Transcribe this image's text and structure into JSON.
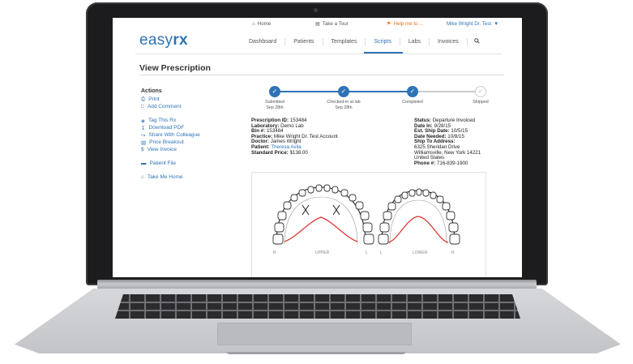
{
  "topbar": {
    "home": "Home",
    "tour": "Take a Tour",
    "help": "Help me to ...",
    "user": "Mike Wright Dr. Test"
  },
  "logo": {
    "part1": "easy",
    "part2": "rx"
  },
  "nav": [
    "Dashboard",
    "Patients",
    "Templates",
    "Scripts",
    "Labs",
    "Invoices"
  ],
  "nav_active": "Scripts",
  "page_title": "View Prescription",
  "actions": {
    "heading": "Actions",
    "group1": [
      "Print",
      "Add Comment"
    ],
    "group2": [
      "Tag This Rx",
      "Download PDF",
      "Share With Colleague",
      "Price Breakout",
      "View Invoice"
    ],
    "group3": [
      "Patient File"
    ],
    "group4": [
      "Take Me Home"
    ]
  },
  "steps": [
    {
      "label": "Submitted",
      "date": "Sep 28th",
      "done": true
    },
    {
      "label": "Checked-in at lab",
      "date": "Sep 28th",
      "done": true
    },
    {
      "label": "Completed",
      "date": "",
      "done": true
    },
    {
      "label": "Shipped",
      "date": "",
      "done": false
    }
  ],
  "details_left": {
    "prescription_id_label": "Prescription ID:",
    "prescription_id": "153484",
    "laboratory_label": "Laboratory:",
    "laboratory": "Demo Lab",
    "bin_label": "Bin #:",
    "bin": "153484",
    "practice_label": "Practice:",
    "practice": "Mike Wright Dr. Test Account",
    "doctor_label": "Doctor:",
    "doctor": "James Wright",
    "patient_label": "Patient:",
    "patient": "Theresa Avila",
    "price_label": "Standard Price:",
    "price": "$138.00"
  },
  "details_right": {
    "status_label": "Status:",
    "status": "Departure Invoiced",
    "date_in_label": "Date In:",
    "date_in": "9/28/15",
    "ship_label": "Est. Ship Date:",
    "ship": "10/5/15",
    "needed_label": "Date Needed:",
    "needed": "10/8/15",
    "ship_to_label": "Ship To Address:",
    "address1": "6325 Sheridan Drive",
    "address2": "Williamsville, New York 14221",
    "address3": "United States",
    "phone_label": "Phone #:",
    "phone": "716-839-1900"
  },
  "diagram": {
    "upper_label": "UPPER",
    "lower_label": "LOWER",
    "r": "R",
    "l": "L"
  },
  "colors": {
    "accent": "#2e73b6",
    "help": "#e8711c",
    "wire": "#d9302c"
  }
}
